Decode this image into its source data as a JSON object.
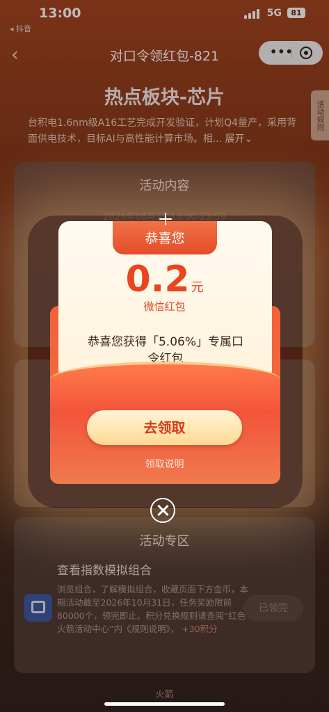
{
  "status_bar": {
    "time": "13:00",
    "back_app": "◂ 抖音",
    "network": "5G",
    "battery": "81"
  },
  "nav": {
    "title": "对口令领红包-821",
    "side_tab": "活动规则"
  },
  "headline": "热点板块-芯片",
  "description": "台积电1.6nm级A16工艺完成开发验证，计划Q4量产，采用背面供电技术，目标AI与高性能计算市场。相...",
  "expand_label": "展开",
  "card1": {
    "title": "活动内容",
    "date": "2026年08月17 13:00-23:59"
  },
  "card3": {
    "title": "活动专区",
    "task_title": "查看指数模拟组合",
    "task_desc": "浏览组合，了解模拟组合，收藏页面下方金币，本期活动截至2026年10月31日，任务奖励限前80000个，领完即止。积分兑换规则请查阅“红色火箭活动中心”内《规则说明》，",
    "task_points": "+30积分",
    "task_button": "已领完"
  },
  "bottom_brand": "火箭",
  "modal": {
    "banner": "恭喜您",
    "amount": "0.2",
    "unit": "元",
    "type": "微信红包",
    "message": "恭喜您获得「5.06%」专属口令红包",
    "claim_button": "去领取",
    "claim_note": "领取说明"
  },
  "colors": {
    "accent": "#e84520",
    "button_fill": "#ffd995",
    "envelope": "#f2543a"
  }
}
